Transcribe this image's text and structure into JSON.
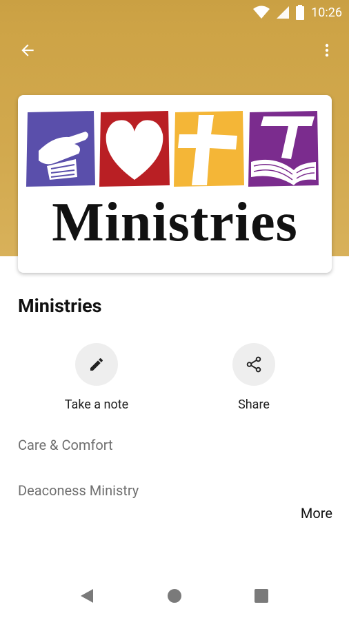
{
  "status_bar": {
    "time": "10:26"
  },
  "app_bar": {
    "back_icon": "arrow-back-icon",
    "menu_icon": "more-vert-icon"
  },
  "hero": {
    "background": "#cda346"
  },
  "logo": {
    "word": "Ministries",
    "tiles": [
      {
        "name": "hands-tile",
        "color": "#5a4fab"
      },
      {
        "name": "heart-tile",
        "color": "#b91f24"
      },
      {
        "name": "cross-tile",
        "color": "#f4b637"
      },
      {
        "name": "bible-tile",
        "color": "#7b2c8e"
      }
    ]
  },
  "page": {
    "title": "Ministries"
  },
  "actions": {
    "note_label": "Take a note",
    "share_label": "Share"
  },
  "items": [
    {
      "label": "Care & Comfort"
    },
    {
      "label": "Deaconess Ministry"
    }
  ],
  "more_label": "More",
  "nav": {
    "back": "nav-back-icon",
    "home": "nav-home-icon",
    "recents": "nav-recents-icon"
  }
}
